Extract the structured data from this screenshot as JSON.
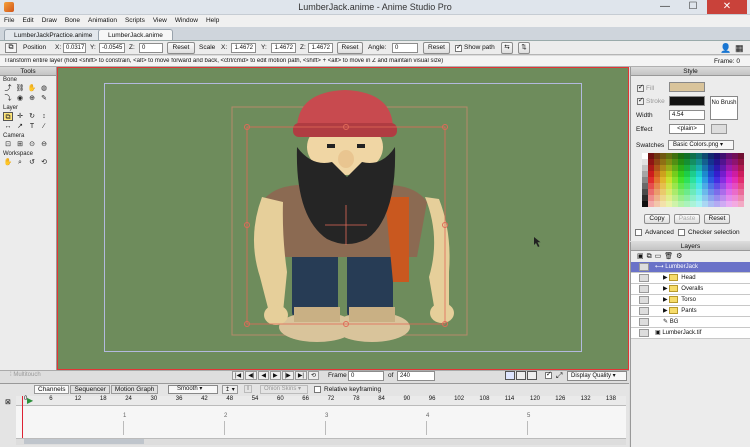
{
  "window": {
    "title": "LumberJack.anime - Anime Studio Pro",
    "controls": [
      "—",
      "☐",
      "✕"
    ]
  },
  "menu": [
    "File",
    "Edit",
    "Draw",
    "Bone",
    "Animation",
    "Scripts",
    "View",
    "Window",
    "Help"
  ],
  "tabs": [
    "LumberJackPractice.anime",
    "LumberJack.anime"
  ],
  "toolopts": {
    "position_label": "Position",
    "x_label": "X:",
    "x": "0.0317",
    "y_label": "Y:",
    "y": "-0.0545",
    "z_label": "Z:",
    "z": "0",
    "reset": "Reset",
    "scale_label": "Scale",
    "sx_label": "X:",
    "sx": "1.4672",
    "sy_label": "Y:",
    "sy": "1.4672",
    "sz_label": "Z:",
    "sz": "1.4672",
    "angle_label": "Angle:",
    "angle": "0",
    "show_path": "Show path"
  },
  "status": {
    "hint": "Transform entire layer (hold <shift> to constrain, <alt> to move forward and back, <ctrl/cmd> to edit motion path, <shift> + <alt> to move in Z and maintain visual size)",
    "frame": "Frame: 0"
  },
  "tools": {
    "title": "Tools",
    "groups": [
      {
        "name": "Bone",
        "rows": [
          [
            "⤴",
            "⛓",
            "✋",
            "◍"
          ],
          [
            "⤵",
            "◉",
            "⊕",
            "✎"
          ]
        ]
      },
      {
        "name": "Layer",
        "rows": [
          [
            "⧉",
            "✛",
            "↻",
            "↕"
          ],
          [
            "↔",
            "↗",
            "T",
            "∕"
          ]
        ]
      },
      {
        "name": "Camera",
        "rows": [
          [
            "⊡",
            "⊞",
            "⊙",
            "⊖"
          ]
        ]
      },
      {
        "name": "Workspace",
        "rows": [
          [
            "✋",
            "🔍",
            "↺",
            "⟲"
          ]
        ]
      }
    ]
  },
  "style": {
    "title": "Style",
    "fill": "Fill",
    "stroke": "Stroke",
    "width_label": "Width",
    "width": "4.54",
    "effect_label": "Effect",
    "effect": "<plain>",
    "nobrush": "No Brush",
    "swatches_label": "Swatches",
    "swatches_file": "Basic Colors.png",
    "copy": "Copy",
    "paste": "Paste",
    "reset": "Reset",
    "advanced": "Advanced",
    "checker": "Checker selection",
    "fill_color": "#d9c49b",
    "stroke_color": "#111111"
  },
  "layers": {
    "title": "Layers",
    "items": [
      {
        "name": "LumberJack",
        "kind": "bone",
        "sel": true,
        "indent": 0
      },
      {
        "name": "Head",
        "kind": "folder",
        "indent": 1
      },
      {
        "name": "Overalls",
        "kind": "folder",
        "indent": 1
      },
      {
        "name": "Torso",
        "kind": "folder",
        "indent": 1
      },
      {
        "name": "Pants",
        "kind": "folder",
        "indent": 1
      },
      {
        "name": "BG",
        "kind": "vector",
        "indent": 1
      },
      {
        "name": "LumberJack.tif",
        "kind": "image",
        "indent": 0
      }
    ]
  },
  "playback": {
    "multitouch": "Multitouch",
    "frame_label": "Frame",
    "frame": "0",
    "of_label": "of",
    "total": "240",
    "quality": "Display Quality"
  },
  "timeline": {
    "tabs": [
      "Channels",
      "Sequencer",
      "Motion Graph"
    ],
    "interp": "Smooth",
    "onion": "Onion Skins",
    "relative": "Relative keyframing",
    "numbers": [
      "0",
      "6",
      "12",
      "18",
      "24",
      "30",
      "36",
      "42",
      "48",
      "54",
      "60",
      "66",
      "72",
      "78",
      "84",
      "90",
      "96",
      "102",
      "108",
      "114",
      "120",
      "126",
      "132",
      "138"
    ],
    "seconds": [
      "1",
      "2",
      "3",
      "4",
      "5"
    ]
  }
}
